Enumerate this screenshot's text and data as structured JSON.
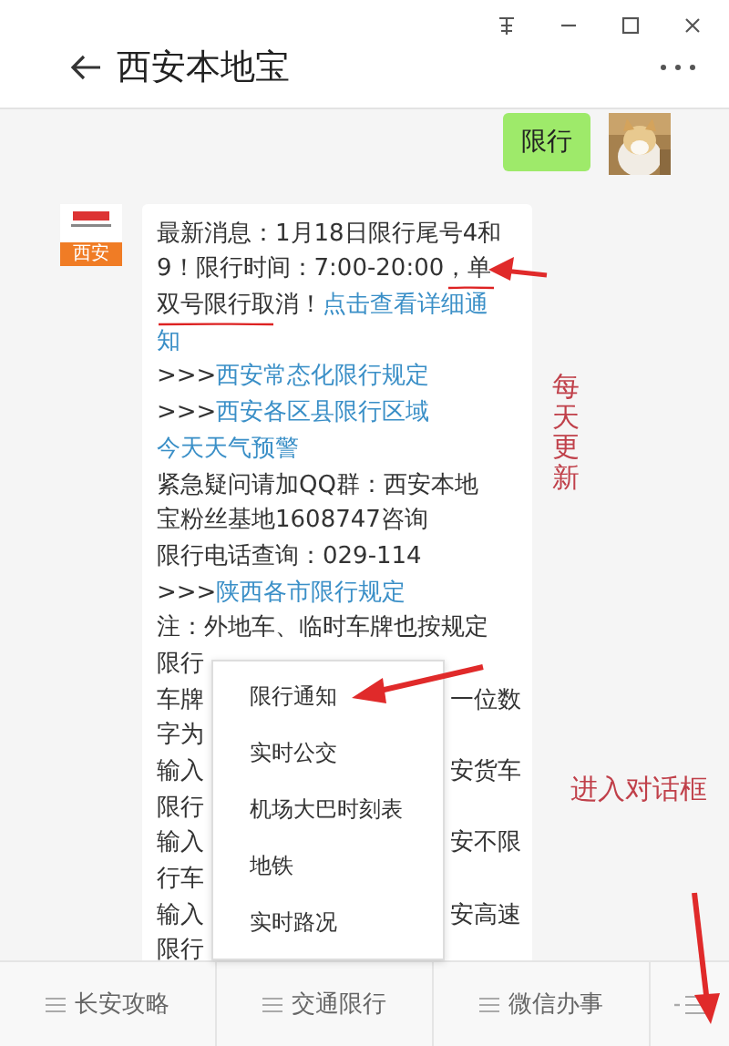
{
  "header": {
    "title": "西安本地宝"
  },
  "messages": [
    {
      "kind": "sent",
      "text": "限行"
    },
    {
      "kind": "received",
      "avatar_label": "西安",
      "lines": [
        {
          "segments": [
            {
              "kind": "plain",
              "text": "最新消息：1月18日限行尾号4和"
            }
          ]
        },
        {
          "segments": [
            {
              "kind": "plain",
              "text": "9！限行时间：7:00-20:00，单"
            }
          ]
        },
        {
          "segments": [
            {
              "kind": "plain",
              "text": "双号限行取消！"
            },
            {
              "kind": "link",
              "text": "点击查看详细通"
            }
          ]
        },
        {
          "segments": [
            {
              "kind": "link",
              "text": "知"
            }
          ]
        },
        {
          "segments": [
            {
              "kind": "plain",
              "text": ">>>"
            },
            {
              "kind": "link",
              "text": "西安常态化限行规定"
            }
          ]
        },
        {
          "segments": [
            {
              "kind": "plain",
              "text": ">>>"
            },
            {
              "kind": "link",
              "text": "西安各区县限行区域"
            }
          ]
        },
        {
          "segments": [
            {
              "kind": "link",
              "text": "今天天气预警"
            }
          ]
        },
        {
          "segments": [
            {
              "kind": "plain",
              "text": "紧急疑问请加QQ群：西安本地"
            }
          ]
        },
        {
          "segments": [
            {
              "kind": "plain",
              "text": "宝粉丝基地1608747咨询"
            }
          ]
        },
        {
          "segments": [
            {
              "kind": "plain",
              "text": "限行电话查询：029-114"
            }
          ]
        },
        {
          "segments": [
            {
              "kind": "plain",
              "text": ">>>"
            },
            {
              "kind": "link",
              "text": "陕西各市限行规定"
            }
          ]
        },
        {
          "segments": [
            {
              "kind": "plain",
              "text": "注：外地车、临时车牌也按规定"
            }
          ]
        },
        {
          "segments": [
            {
              "kind": "plain",
              "text": "限行"
            }
          ]
        },
        {
          "segments": [
            {
              "kind": "plain",
              "text": "车牌"
            }
          ],
          "tail": "一位数"
        },
        {
          "segments": [
            {
              "kind": "plain",
              "text": "字为"
            }
          ]
        },
        {
          "segments": [
            {
              "kind": "plain",
              "text": "输入"
            }
          ],
          "tail": "安货车"
        },
        {
          "segments": [
            {
              "kind": "plain",
              "text": "限行"
            }
          ]
        },
        {
          "segments": [
            {
              "kind": "plain",
              "text": "输入"
            }
          ],
          "tail": "安不限"
        },
        {
          "segments": [
            {
              "kind": "plain",
              "text": "行车"
            }
          ]
        },
        {
          "segments": [
            {
              "kind": "plain",
              "text": "输入"
            }
          ],
          "tail": "安高速"
        },
        {
          "segments": [
            {
              "kind": "plain",
              "text": "限行"
            }
          ]
        }
      ]
    }
  ],
  "popup_menu": {
    "items": [
      "限行通知",
      "实时公交",
      "机场大巴时刻表",
      "地铁",
      "实时路况"
    ]
  },
  "bottom_menu": {
    "items": [
      {
        "kind": "menu",
        "label": "长安攻略"
      },
      {
        "kind": "menu",
        "label": "交通限行"
      },
      {
        "kind": "menu",
        "label": "微信办事"
      },
      {
        "kind": "keyboard"
      }
    ]
  },
  "annotations": [
    {
      "kind": "vertical",
      "text": "每天更新"
    },
    {
      "kind": "horizontal",
      "text": "进入对话框"
    }
  ]
}
